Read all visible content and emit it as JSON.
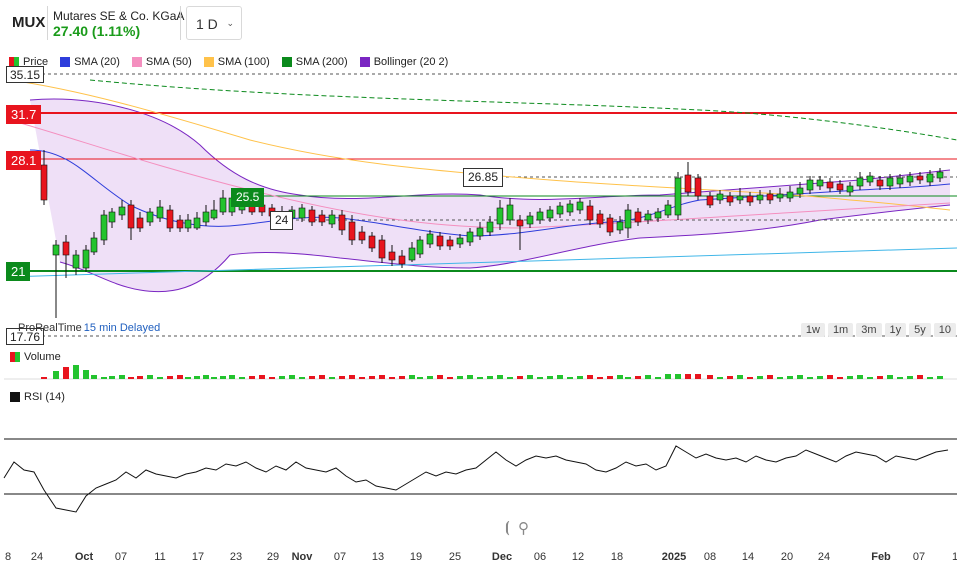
{
  "header": {
    "ticker": "MUX",
    "company": "Mutares SE & Co. KGaA",
    "quote": "27.40 (1.11%)",
    "timeframe": "1 D",
    "quote_color": "#1a9b1a"
  },
  "legend": {
    "items": [
      {
        "label": "Price",
        "color": "price"
      },
      {
        "label": "SMA (20)",
        "color": "#2e3ddb"
      },
      {
        "label": "SMA (50)",
        "color": "#f48fbf"
      },
      {
        "label": "SMA (100)",
        "color": "#ffc24a"
      },
      {
        "label": "SMA (200)",
        "color": "#0b8a1c"
      },
      {
        "label": "Bollinger (20 2)",
        "color": "#7a26c2"
      }
    ]
  },
  "price_levels": {
    "top": "35.15",
    "red1": "31.7",
    "red2": "28.1",
    "green_low": "21",
    "bottom": "17.76",
    "green_mid": "25.5"
  },
  "annotations": {
    "a1": "26.85",
    "a2": "24"
  },
  "footer": {
    "source": "ProRealTime",
    "delay": "15 min Delayed",
    "ranges": [
      "1w",
      "1m",
      "3m",
      "1y",
      "5y",
      "10"
    ]
  },
  "panels": {
    "volume": "Volume",
    "rsi": "RSI (14)"
  },
  "controls": {
    "zoom_out": "⦖",
    "zoom_in": "🔍"
  },
  "x_axis": [
    {
      "label": "8",
      "bold": false
    },
    {
      "label": "24",
      "bold": false
    },
    {
      "label": "Oct",
      "bold": true
    },
    {
      "label": "07",
      "bold": false
    },
    {
      "label": "11",
      "bold": false
    },
    {
      "label": "17",
      "bold": false
    },
    {
      "label": "23",
      "bold": false
    },
    {
      "label": "29",
      "bold": false
    },
    {
      "label": "Nov",
      "bold": true
    },
    {
      "label": "07",
      "bold": false
    },
    {
      "label": "13",
      "bold": false
    },
    {
      "label": "19",
      "bold": false
    },
    {
      "label": "25",
      "bold": false
    },
    {
      "label": "Dec",
      "bold": true
    },
    {
      "label": "06",
      "bold": false
    },
    {
      "label": "12",
      "bold": false
    },
    {
      "label": "18",
      "bold": false
    },
    {
      "label": "2025",
      "bold": true
    },
    {
      "label": "08",
      "bold": false
    },
    {
      "label": "14",
      "bold": false
    },
    {
      "label": "20",
      "bold": false
    },
    {
      "label": "24",
      "bold": false
    },
    {
      "label": "Feb",
      "bold": true
    },
    {
      "label": "07",
      "bold": false
    },
    {
      "label": "1",
      "bold": false
    }
  ],
  "colors": {
    "up": "#23c32e",
    "down": "#e8141e",
    "sma20": "#2e3ddb",
    "sma50": "#f48fbf",
    "sma100": "#ffc24a",
    "sma200": "#0b8a1c",
    "bollinger": "#7a26c2",
    "bollinger_fill": "#efe0f7",
    "trend": "#3fb6e8"
  }
}
